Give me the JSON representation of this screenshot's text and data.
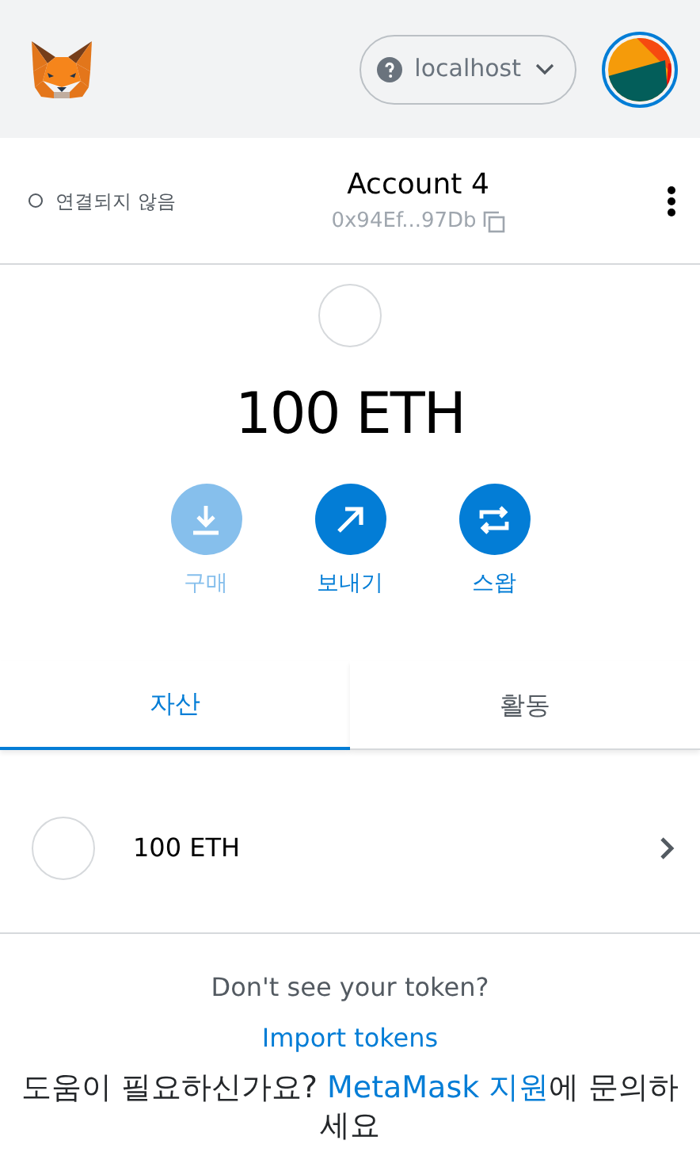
{
  "header": {
    "network": "localhost"
  },
  "account": {
    "connection": "연결되지 않음",
    "connected": false,
    "name": "Account 4",
    "address": "0x94Ef...97Db"
  },
  "balance": "100 ETH",
  "actions": [
    {
      "kind": "buy",
      "label": "구매",
      "disabled": true
    },
    {
      "kind": "send",
      "label": "보내기",
      "disabled": false
    },
    {
      "kind": "swap",
      "label": "스왑",
      "disabled": false
    }
  ],
  "tabs": [
    {
      "label": "자산",
      "selected": true
    },
    {
      "label": "활동",
      "selected": false
    }
  ],
  "assets": [
    {
      "amount": "100 ETH"
    }
  ],
  "token_help": {
    "question": "Don't see your token?",
    "link": "Import tokens"
  },
  "support": {
    "before": "도움이 필요하신가요? ",
    "link": "MetaMask 지원",
    "after": "에 문의하세요"
  }
}
